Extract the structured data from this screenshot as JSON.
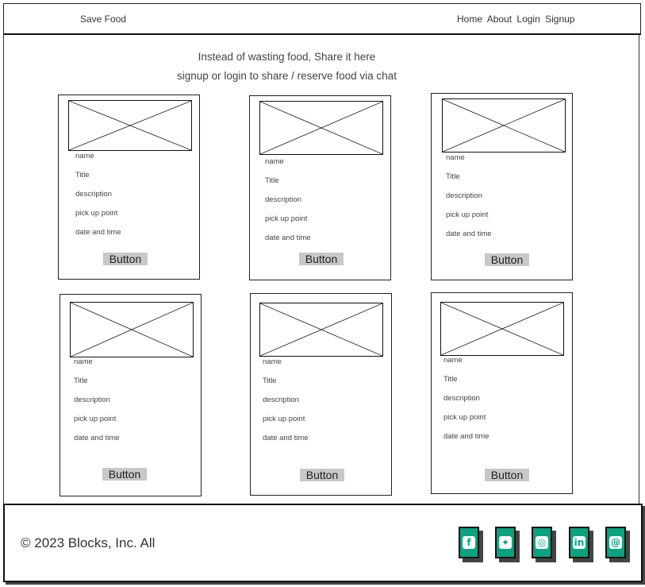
{
  "navbar": {
    "brand": "Save Food",
    "links": [
      "Home",
      "About",
      "Login",
      "Signup"
    ]
  },
  "hero": {
    "line1": "Instead of wasting food, Share it here",
    "line2": "signup or login to share / reserve food via chat"
  },
  "card_fields": {
    "name": "name",
    "title": "Title",
    "description": "description",
    "pickup": "pick up point",
    "datetime": "date and time",
    "button": "Button"
  },
  "footer": {
    "copyright": "© 2023 Blocks, Inc. All"
  },
  "social_icons": [
    "facebook-icon",
    "twitter-icon",
    "instagram-icon",
    "linkedin-icon",
    "threads-icon"
  ],
  "colors": {
    "social_green": "#0aa37f",
    "button_gray": "#c8c8c8"
  }
}
